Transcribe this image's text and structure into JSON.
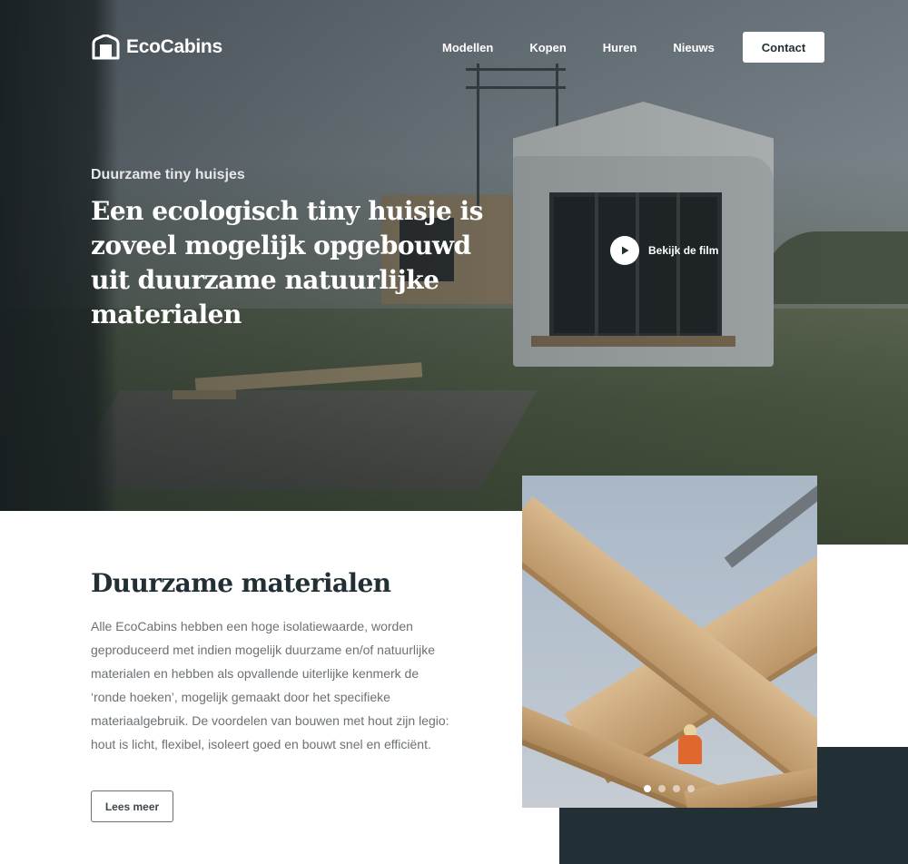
{
  "header": {
    "logo_text": "EcoCabins",
    "nav": [
      {
        "label": "Modellen"
      },
      {
        "label": "Kopen"
      },
      {
        "label": "Huren"
      },
      {
        "label": "Nieuws"
      }
    ],
    "contact_label": "Contact"
  },
  "hero": {
    "eyebrow": "Duurzame tiny huisjes",
    "title": "Een ecologisch tiny huisje is zoveel mogelijk opgebouwd uit duurzame natuurlijke materialen",
    "film_label": "Bekijk de film",
    "play_icon": "play-icon"
  },
  "section": {
    "title": "Duurzame materialen",
    "text": "Alle EcoCabins hebben een hoge isolatiewaarde, worden geproduceerd met indien mogelijk duurzame en/of natuurlijke materialen en hebben als opvallende uiterlijke kenmerk de ‘ronde hoeken’, mogelijk gemaakt door het specifieke materiaalgebruik. De voordelen van bouwen met hout zijn legio: hout is licht, flexibel, isoleert goed en bouwt snel en efficiënt.",
    "button_label": "Lees meer"
  },
  "carousel": {
    "total_slides": 4,
    "active_slide": 1
  },
  "colors": {
    "dark": "#223036",
    "text_muted": "#6b7175",
    "white": "#ffffff"
  }
}
